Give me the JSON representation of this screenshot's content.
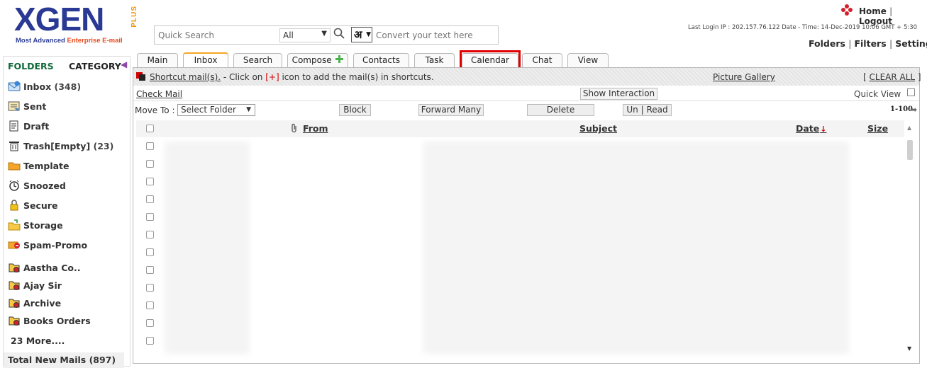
{
  "logo": {
    "word": "XGEN",
    "plus": "PLUS",
    "tagline_a": "Most Advanced ",
    "tagline_b": "Enterprise E-mail"
  },
  "search": {
    "placeholder": "Quick Search",
    "scope_value": "All",
    "hindi_label": "अ",
    "convert_placeholder": "Convert your text here"
  },
  "header": {
    "home": "Home",
    "logout": "Logout",
    "last_login": "Last Login IP : 202.157.76.122 Date - Time: 14-Dec-2019 10:06 GMT + 5:30",
    "folders": "Folders",
    "filters": "Filters",
    "settings": "Settings"
  },
  "sidebar": {
    "folders_title": "FOLDERS",
    "category_title": "CATEGORY",
    "items": [
      {
        "label": "Inbox",
        "count": "(348)",
        "icon": "inbox-icon"
      },
      {
        "label": "Sent",
        "count": "",
        "icon": "sent-icon"
      },
      {
        "label": "Draft",
        "count": "",
        "icon": "draft-icon"
      },
      {
        "label": "Trash[Empty]",
        "count": "(23)",
        "icon": "trash-icon"
      },
      {
        "label": "Template",
        "count": "",
        "icon": "template-folder-icon"
      },
      {
        "label": "Snoozed",
        "count": "",
        "icon": "snooze-clock-icon"
      },
      {
        "label": "Secure",
        "count": "",
        "icon": "lock-icon"
      },
      {
        "label": "Storage",
        "count": "",
        "icon": "storage-folder-icon"
      },
      {
        "label": "Spam-Promo",
        "count": "",
        "icon": "spam-icon"
      },
      {
        "label": "Aastha Co..",
        "count": "",
        "icon": "custom-folder-icon"
      },
      {
        "label": "Ajay Sir",
        "count": "",
        "icon": "custom-folder-icon"
      },
      {
        "label": "Archive",
        "count": "",
        "icon": "custom-folder-icon"
      },
      {
        "label": "Books Orders",
        "count": "",
        "icon": "custom-folder-icon"
      }
    ],
    "more": "23 More....",
    "total_new": "Total New Mails (897)"
  },
  "tabs": [
    "Main",
    "Inbox",
    "Search",
    "Compose",
    "Contacts",
    "Task",
    "Calendar",
    "Chat",
    "View"
  ],
  "shortcut": {
    "link": "Shortcut mail(s).",
    "text_a": " - Click on ",
    "marker": "[+]",
    "text_b": " icon to add the mail(s) in shortcuts.",
    "gallery": "Picture Gallery",
    "clear_open": "[ ",
    "clear": "CLEAR ALL",
    "clear_close": " ]"
  },
  "toolbar": {
    "check_mail": "Check Mail",
    "show_interaction": "Show Interaction",
    "quick_view": "Quick View",
    "move_to": "Move To :",
    "select_folder": "Select Folder",
    "block": "Block",
    "forward_many": "Forward Many",
    "delete": "Delete",
    "unread": "Un | Read",
    "pager": "1-100"
  },
  "table": {
    "from": "From",
    "subject": "Subject",
    "date": "Date",
    "size": "Size"
  },
  "colors": {
    "brand": "#2a3a94",
    "accent": "#f39200",
    "highlight": "#e00000",
    "folders": "#0f6a3a"
  }
}
